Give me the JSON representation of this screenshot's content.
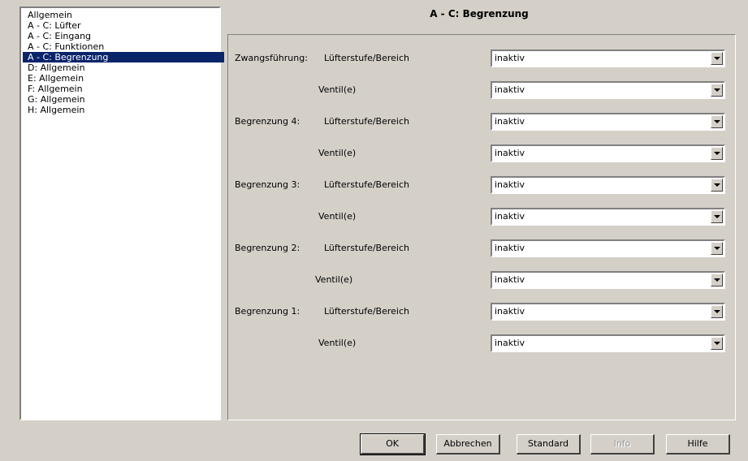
{
  "sidebar": {
    "items": [
      {
        "label": "Allgemein"
      },
      {
        "label": "A - C: Lüfter"
      },
      {
        "label": "A - C: Eingang"
      },
      {
        "label": "A - C: Funktionen"
      },
      {
        "label": "A - C: Begrenzung",
        "selected": true
      },
      {
        "label": "D: Allgemein"
      },
      {
        "label": "E: Allgemein"
      },
      {
        "label": "F: Allgemein"
      },
      {
        "label": "G: Allgemein"
      },
      {
        "label": "H: Allgemein"
      }
    ]
  },
  "header": {
    "title": "A - C: Begrenzung"
  },
  "form": {
    "rows": [
      {
        "group": "Zwangsführung:",
        "label": "Lüfterstufe/Bereich",
        "value": "inaktiv"
      },
      {
        "group": "",
        "label": "Ventil(e)",
        "value": "inaktiv"
      },
      {
        "group": "Begrenzung 4:",
        "label": "Lüfterstufe/Bereich",
        "value": "inaktiv"
      },
      {
        "group": "",
        "label": "Ventil(e)",
        "value": "inaktiv"
      },
      {
        "group": "Begrenzung 3:",
        "label": "Lüfterstufe/Bereich",
        "value": "inaktiv"
      },
      {
        "group": "",
        "label": "Ventil(e)",
        "value": "inaktiv"
      },
      {
        "group": "Begrenzung 2:",
        "label": "Lüfterstufe/Bereich",
        "value": "inaktiv"
      },
      {
        "group": "",
        "label": "Ventil(e)",
        "value": "inaktiv"
      },
      {
        "group": "Begrenzung 1:",
        "label": "Lüfterstufe/Bereich",
        "value": "inaktiv"
      },
      {
        "group": "",
        "label": "Ventil(e)",
        "value": "inaktiv"
      }
    ]
  },
  "buttons": {
    "ok": "OK",
    "cancel": "Abbrechen",
    "standard": "Standard",
    "info": "Info",
    "help": "Hilfe"
  }
}
